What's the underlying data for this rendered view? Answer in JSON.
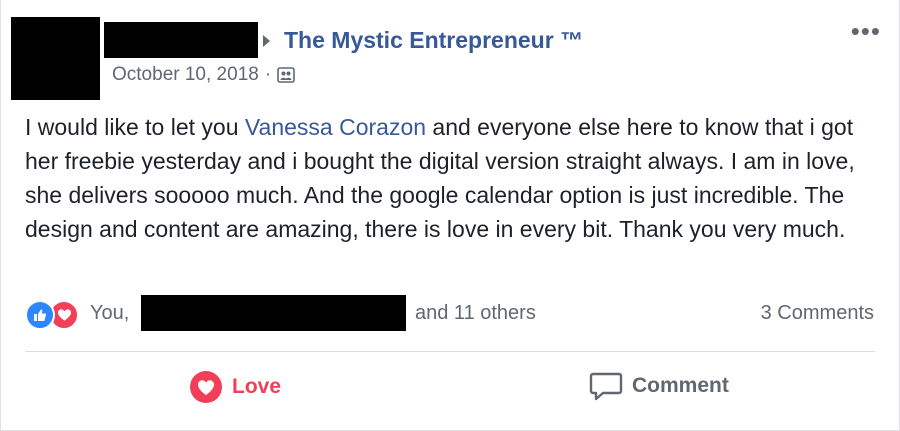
{
  "post": {
    "group_name": "The Mystic Entrepreneur ™",
    "date": "October 10, 2018",
    "separator": "·",
    "audience_icon": "group-icon",
    "more_label": "•••",
    "text_before_mention": "I would like to let you ",
    "mention": "Vanessa Corazon",
    "text_after_mention": " and everyone else here to know that i got her freebie yesterday and i bought the digital version straight always. I am in love, she delivers sooooo much. And the google calendar option is just incredible. The design and content are amazing, there is love in every bit. Thank you very much."
  },
  "reactions": {
    "icons": [
      "like-icon",
      "love-icon"
    ],
    "you_label": "You,",
    "others_label": "and 11 others",
    "comments_count": "3 Comments"
  },
  "actions": {
    "love_label": "Love",
    "comment_label": "Comment"
  },
  "colors": {
    "link_blue": "#385898",
    "love_red": "#f33e58",
    "like_blue": "#2d88ff",
    "secondary_text": "#616770"
  }
}
